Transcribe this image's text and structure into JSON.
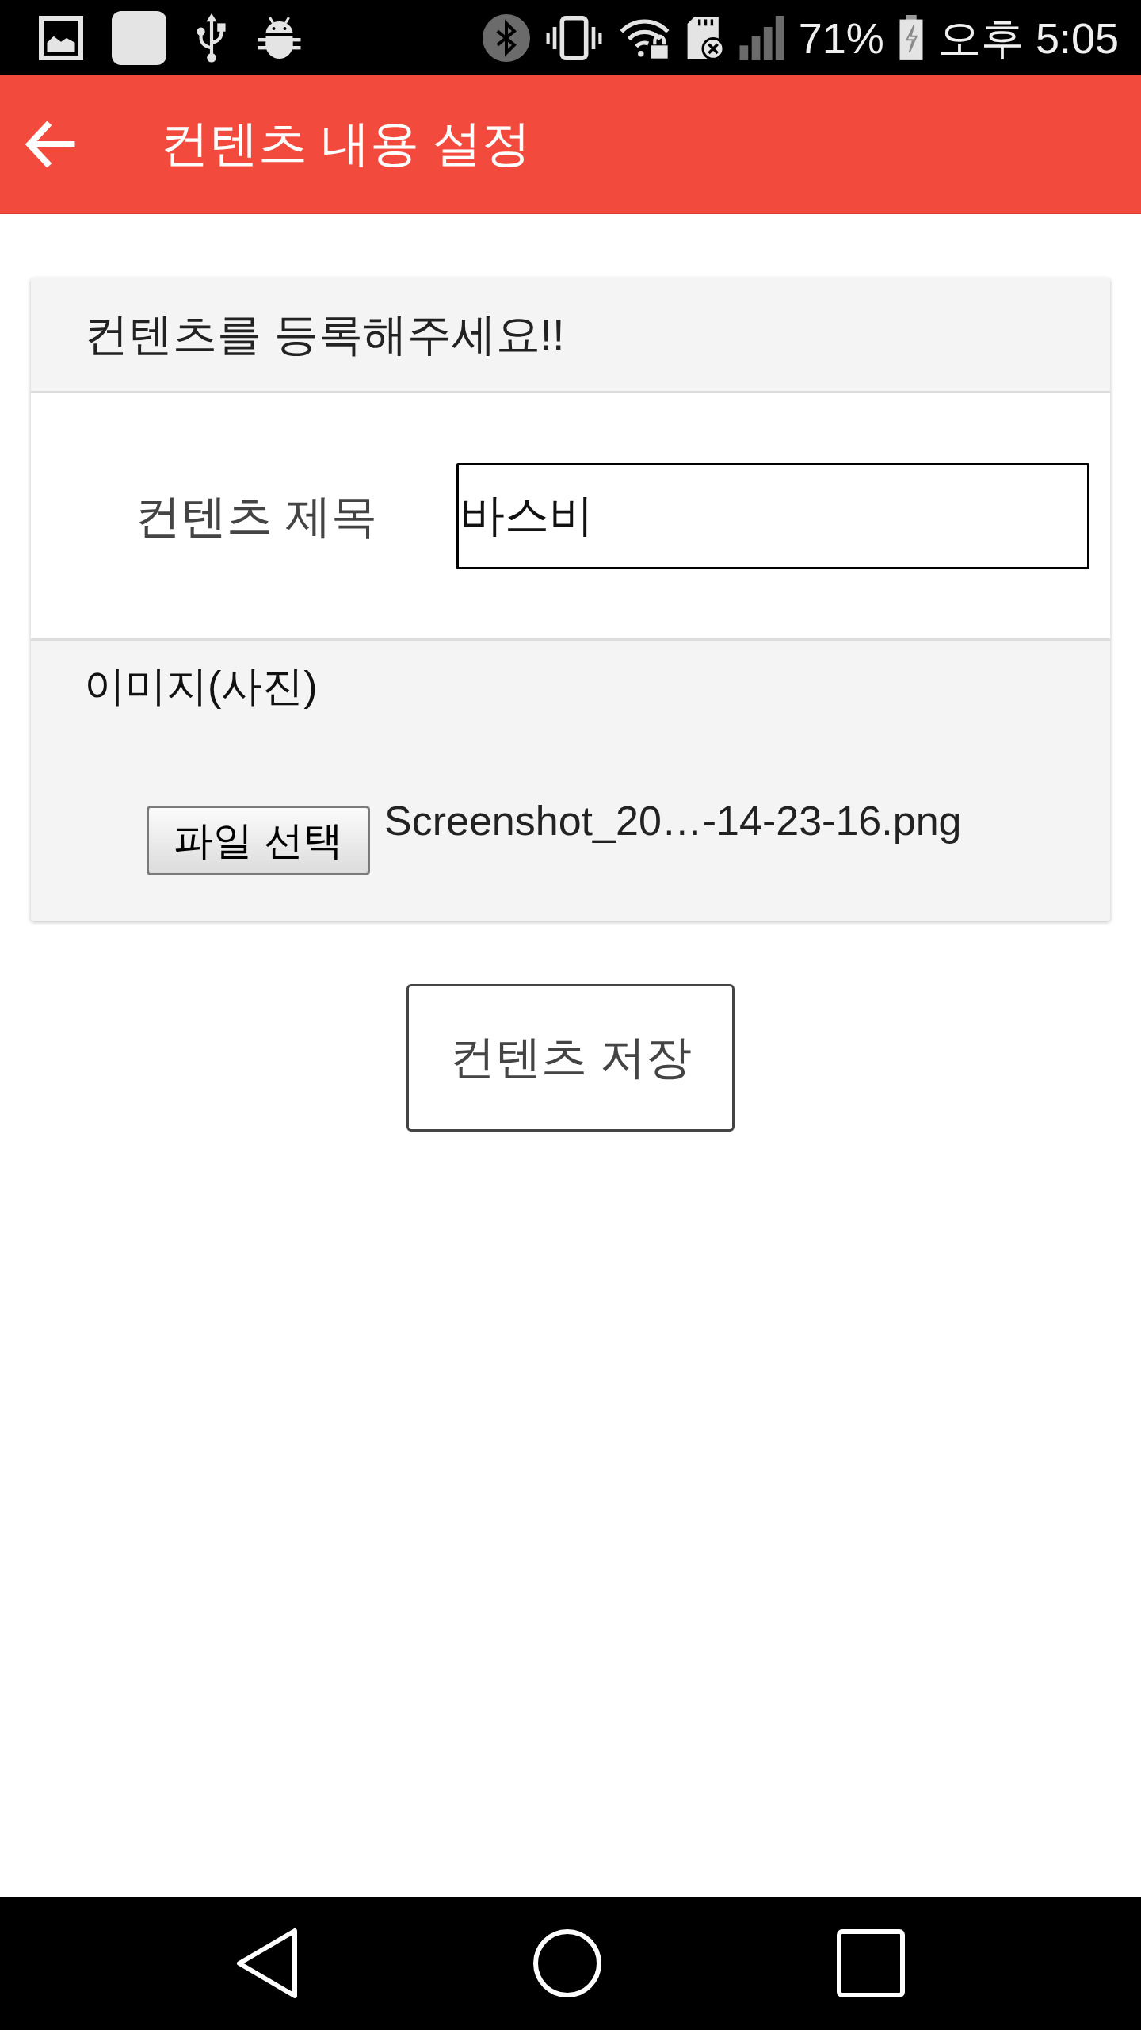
{
  "status_bar": {
    "battery_text": "71%",
    "clock": "오후 5:05"
  },
  "app_bar": {
    "title": "컨텐츠 내용 설정"
  },
  "form_card": {
    "heading": "컨텐츠를 등록해주세요!!",
    "title_field": {
      "label": "컨텐츠 제목",
      "value": "바스비"
    },
    "image_field": {
      "label": "이미지(사진)",
      "file_button": "파일 선택",
      "file_name": "Screenshot_20…-14-23-16.png"
    }
  },
  "save_button": {
    "label": "컨텐츠 저장"
  }
}
